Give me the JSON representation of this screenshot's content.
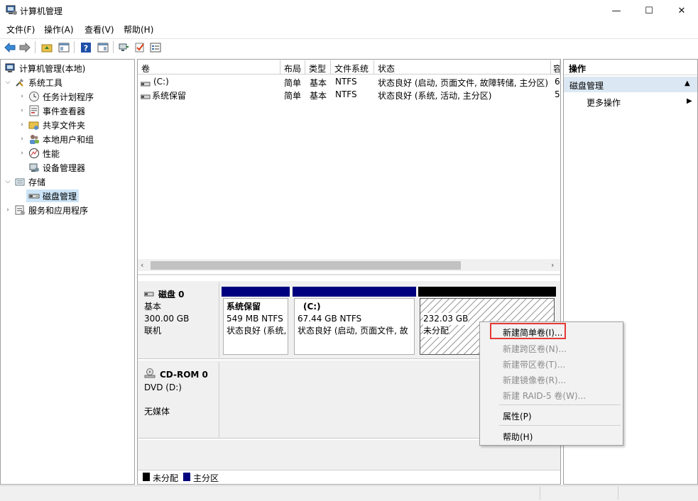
{
  "window": {
    "title": "计算机管理",
    "minimize_glyph": "—",
    "maximize_glyph": "☐",
    "close_glyph": "✕"
  },
  "menu": [
    "文件(F)",
    "操作(A)",
    "查看(V)",
    "帮助(H)"
  ],
  "tree": {
    "root": "计算机管理(本地)",
    "system_tools": "系统工具",
    "task_scheduler": "任务计划程序",
    "event_viewer": "事件查看器",
    "shared_folders": "共享文件夹",
    "local_users": "本地用户和组",
    "performance": "性能",
    "device_manager": "设备管理器",
    "storage": "存储",
    "disk_management": "磁盘管理",
    "services_apps": "服务和应用程序"
  },
  "volume_table": {
    "columns": [
      "卷",
      "布局",
      "类型",
      "文件系统",
      "状态",
      "容"
    ],
    "rows": [
      {
        "name": "(C:)",
        "layout": "简单",
        "type": "基本",
        "fs": "NTFS",
        "status": "状态良好 (启动, 页面文件, 故障转储, 主分区)",
        "cap": "6"
      },
      {
        "name": "系统保留",
        "layout": "简单",
        "type": "基本",
        "fs": "NTFS",
        "status": "状态良好 (系统, 活动, 主分区)",
        "cap": "5"
      }
    ]
  },
  "disk0": {
    "name": "磁盘 0",
    "type": "基本",
    "size": "300.00 GB",
    "state": "联机",
    "partitions": [
      {
        "title": "系统保留",
        "size": "549 MB NTFS",
        "status": "状态良好 (系统,"
      },
      {
        "title": "(C:)",
        "size": "67.44 GB NTFS",
        "status": "状态良好 (启动, 页面文件, 故"
      },
      {
        "title": "",
        "size": "232.03 GB",
        "status": "未分配"
      }
    ]
  },
  "cdrom": {
    "name": "CD-ROM 0",
    "drive": "DVD (D:)",
    "media": "无媒体"
  },
  "legend": {
    "unallocated": "未分配",
    "primary": "主分区"
  },
  "context_menu": {
    "new_simple": "新建简单卷(I)...",
    "new_spanned": "新建跨区卷(N)...",
    "new_striped": "新建带区卷(T)...",
    "new_mirrored": "新建镜像卷(R)...",
    "new_raid5": "新建 RAID-5 卷(W)...",
    "properties": "属性(P)",
    "help": "帮助(H)"
  },
  "actions": {
    "header": "操作",
    "section": "磁盘管理",
    "more": "更多操作"
  },
  "colors": {
    "primary_partition": "#00007f",
    "unallocated": "#000000",
    "highlight_box": "#e53935",
    "selection_bg": "#cce4f7"
  }
}
